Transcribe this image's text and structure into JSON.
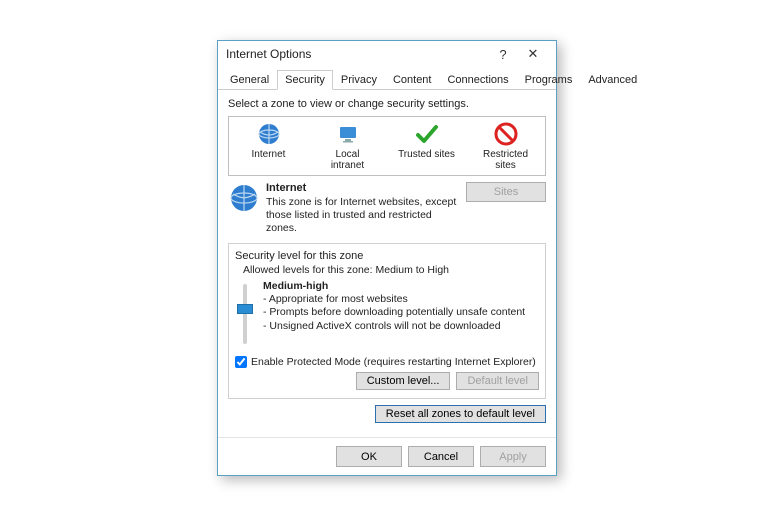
{
  "window": {
    "title": "Internet Options",
    "help": "?",
    "close": "✕"
  },
  "tabs": [
    "General",
    "Security",
    "Privacy",
    "Content",
    "Connections",
    "Programs",
    "Advanced"
  ],
  "active_tab": 1,
  "zone_group": {
    "legend": "Select a zone to view or change security settings."
  },
  "zones": [
    {
      "label": "Internet",
      "icon": "globe-icon"
    },
    {
      "label": "Local intranet",
      "icon": "monitor-icon"
    },
    {
      "label": "Trusted sites",
      "icon": "check-icon"
    },
    {
      "label": "Restricted sites",
      "icon": "noentry-icon"
    }
  ],
  "selected_zone": 0,
  "zone_desc": {
    "name": "Internet",
    "text": "This zone is for Internet websites, except those listed in trusted and restricted zones.",
    "sites_btn": "Sites"
  },
  "security": {
    "legend": "Security level for this zone",
    "allowed": "Allowed levels for this zone: Medium to High",
    "level_name": "Medium-high",
    "bullet1": "- Appropriate for most websites",
    "bullet2": "- Prompts before downloading potentially unsafe content",
    "bullet3": "- Unsigned ActiveX controls will not be downloaded",
    "protected_mode": "Enable Protected Mode (requires restarting Internet Explorer)",
    "protected_mode_checked": true,
    "custom_btn": "Custom level...",
    "default_btn": "Default level",
    "reset_btn": "Reset all zones to default level"
  },
  "footer": {
    "ok": "OK",
    "cancel": "Cancel",
    "apply": "Apply"
  }
}
